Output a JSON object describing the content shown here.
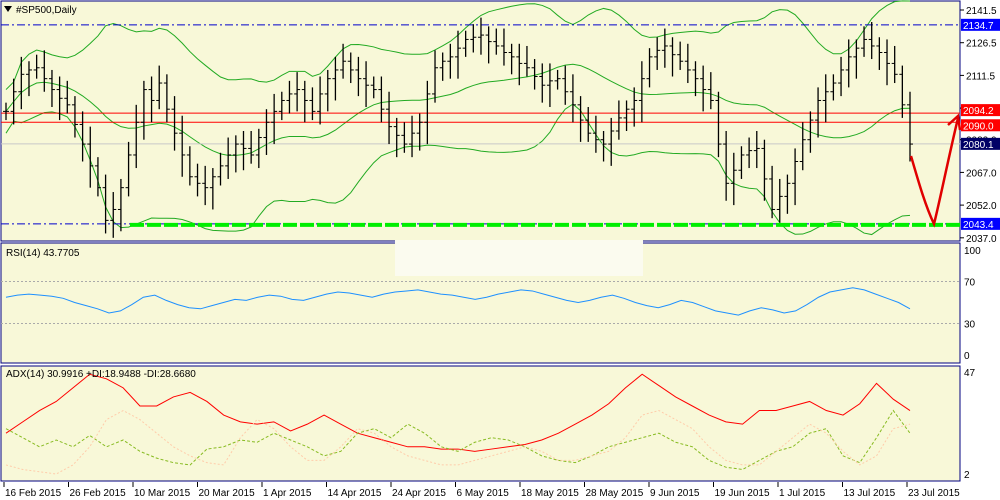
{
  "title": "#SP500,Daily",
  "colors": {
    "bg": "#f8f8d8",
    "frame": "#000080",
    "bars": "#000000",
    "bands": "#22aa22",
    "support": "#00ee00",
    "resistance_line": "#0000cc",
    "red": "#ff0000",
    "adx": "#ff0000",
    "plus_di": "#88bb22",
    "minus_di": "#ffccaa",
    "rsi": "#1e90ff"
  },
  "price_axis": {
    "ticks": [
      "2141.5",
      "2126.5",
      "2111.5",
      "2096.5",
      "2082.0",
      "2067.0",
      "2052.0",
      "2037.0"
    ],
    "min": 2035,
    "max": 2145
  },
  "price_labels": [
    {
      "value": 2134.7,
      "text": "2134.7",
      "color": "#0000ff",
      "style": "dashdot"
    },
    {
      "value": 2094.2,
      "text": "2094.2",
      "color": "#ff0000",
      "style": "solid"
    },
    {
      "value": 2090.0,
      "text": "2090.0",
      "color": "#ff0000",
      "style": "solid"
    },
    {
      "value": 2080.1,
      "text": "2080.1",
      "color": "#000066",
      "style": "grey"
    },
    {
      "value": 2043.4,
      "text": "2043.4",
      "color": "#0000ff",
      "style": "support"
    }
  ],
  "dates": [
    "16 Feb 2015",
    "26 Feb 2015",
    "10 Mar 2015",
    "20 Mar 2015",
    "1 Apr 2015",
    "14 Apr 2015",
    "24 Apr 2015",
    "6 May 2015",
    "18 May 2015",
    "28 May 2015",
    "9 Jun 2015",
    "19 Jun 2015",
    "1 Jul 2015",
    "13 Jul 2015",
    "23 Jul 2015"
  ],
  "rsi": {
    "label": "RSI(14) 43.7705",
    "ticks": [
      "100",
      "70",
      "30",
      "0"
    ]
  },
  "adx": {
    "label": "ADX(14) 30.9916 +DI:18.9488 -DI:28.6680",
    "ticks": [
      "47",
      "2"
    ]
  },
  "chart_data": {
    "type": "ohlc",
    "closes": [
      2095,
      2104,
      2112,
      2114,
      2115,
      2110,
      2105,
      2101,
      2098,
      2089,
      2080,
      2070,
      2060,
      2045,
      2050,
      2060,
      2075,
      2090,
      2105,
      2100,
      2108,
      2096,
      2085,
      2075,
      2065,
      2062,
      2060,
      2065,
      2070,
      2075,
      2080,
      2078,
      2075,
      2083,
      2090,
      2095,
      2100,
      2103,
      2105,
      2100,
      2095,
      2103,
      2110,
      2114,
      2118,
      2114,
      2110,
      2107,
      2105,
      2096,
      2088,
      2084,
      2080,
      2085,
      2090,
      2103,
      2115,
      2118,
      2120,
      2124,
      2128,
      2129,
      2130,
      2127,
      2125,
      2122,
      2120,
      2117,
      2115,
      2111,
      2107,
      2109,
      2110,
      2104,
      2098,
      2091,
      2085,
      2082,
      2080,
      2086,
      2092,
      2096,
      2100,
      2110,
      2120,
      2123,
      2125,
      2121,
      2118,
      2114,
      2110,
      2105,
      2100,
      2080,
      2062,
      2068,
      2075,
      2077,
      2078,
      2064,
      2050,
      2056,
      2062,
      2072,
      2082,
      2091,
      2100,
      2104,
      2108,
      2114,
      2120,
      2124,
      2128,
      2125,
      2122,
      2117,
      2112,
      2098,
      2080
    ],
    "rsi_values": [
      55,
      57,
      58,
      57,
      56,
      54,
      50,
      47,
      44,
      40,
      42,
      48,
      55,
      57,
      52,
      48,
      45,
      44,
      47,
      50,
      53,
      52,
      55,
      57,
      56,
      53,
      52,
      55,
      58,
      60,
      59,
      57,
      55,
      58,
      60,
      61,
      62,
      60,
      58,
      57,
      55,
      53,
      55,
      58,
      60,
      62,
      61,
      58,
      55,
      52,
      50,
      52,
      55,
      57,
      54,
      50,
      47,
      45,
      48,
      52,
      50,
      46,
      42,
      40,
      38,
      42,
      45,
      43,
      40,
      42,
      48,
      55,
      60,
      62,
      64,
      62,
      58,
      54,
      50,
      44
    ],
    "adx_values": [
      20,
      25,
      30,
      34,
      40,
      46,
      44,
      40,
      32,
      32,
      36,
      38,
      34,
      28,
      25,
      24,
      25,
      21,
      24,
      28,
      24,
      20,
      18,
      16,
      14,
      14,
      13,
      13,
      12,
      13,
      14,
      15,
      17,
      20,
      24,
      28,
      33,
      40,
      46,
      41,
      36,
      32,
      28,
      25,
      24,
      30,
      30,
      32,
      34,
      30,
      28,
      33,
      42,
      35,
      30
    ],
    "plus_di_values": [
      22,
      18,
      14,
      17,
      14,
      19,
      14,
      17,
      12,
      9,
      7,
      6,
      13,
      14,
      17,
      16,
      20,
      17,
      14,
      10,
      12,
      20,
      22,
      18,
      24,
      20,
      14,
      12,
      16,
      18,
      17,
      14,
      10,
      8,
      7,
      10,
      14,
      16,
      18,
      20,
      16,
      14,
      8,
      5,
      4,
      8,
      12,
      14,
      20,
      22,
      10,
      7,
      18,
      30,
      20
    ],
    "minus_di_values": [
      6,
      4,
      3,
      2,
      6,
      14,
      26,
      30,
      26,
      20,
      14,
      10,
      7,
      6,
      18,
      26,
      22,
      14,
      8,
      8,
      14,
      22,
      20,
      14,
      10,
      8,
      6,
      6,
      8,
      10,
      12,
      14,
      12,
      8,
      8,
      10,
      12,
      18,
      28,
      30,
      26,
      22,
      14,
      8,
      6,
      6,
      12,
      18,
      24,
      20,
      12,
      6,
      10,
      22,
      24
    ],
    "yrange": [
      2035,
      2145
    ]
  }
}
